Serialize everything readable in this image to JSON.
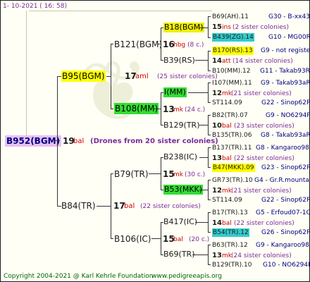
{
  "header": {
    "timestamp": "1-  10-2021  (  16:  58)"
  },
  "watermark": {
    "glyph": "❦"
  },
  "root": {
    "id": "B952(BGM)",
    "count": "19",
    "suffix": "bal",
    "colonies": "(Drones from 20 sister colonies)"
  },
  "g1": {
    "mother": {
      "id": "B95(BGM)",
      "count": "17",
      "suffix": "aml",
      "colonies": "(25 sister colonies)"
    },
    "father": {
      "id": "B84(TR)",
      "count": "17",
      "suffix": "bal",
      "colonies": "(22 sister colonies)"
    }
  },
  "g2": {
    "a": {
      "id": "B121(BGM)",
      "count": "16",
      "suffix": "hbg",
      "colonies": "(8 c.)"
    },
    "b": {
      "id": "B108(MM)",
      "count": "13",
      "suffix": "mk",
      "colonies": "(24 c.)"
    },
    "c": {
      "id": "B79(TR)",
      "count": "15",
      "suffix": "mk",
      "colonies": "(30 c.)"
    },
    "d": {
      "id": "B106(IC)",
      "count": "15",
      "suffix": "bal",
      "colonies": "(20 c.)"
    }
  },
  "g3": {
    "a1": "B18(BGM)",
    "a2": "B39(RS)",
    "b1": "I(MM)",
    "b2": "B129(TR)",
    "c1": "B238(IC)",
    "c2": "B53(MKK)",
    "d1": "B417(IC)",
    "d2": "B69(TR)"
  },
  "g4": [
    {
      "id": "B69(AH).11",
      "ref": "G30 - B-xx43"
    },
    {
      "count": "15",
      "suffix": "ins",
      "colonies": "(2 sister colonies)"
    },
    {
      "id": "B439(ZG).14",
      "ref": "G10 - MG00R"
    },
    {
      "id": "B170(RS).13",
      "ref": "G9 - not registe"
    },
    {
      "count": "14",
      "suffix": "att",
      "colonies": "(14 sister colonies)"
    },
    {
      "id": "B10(MM).12",
      "ref": "G11 - Takab93R"
    },
    {
      "id": "I107(MM).11",
      "ref": "G9 - Takab93aR"
    },
    {
      "count": "12",
      "suffix": "mk",
      "colonies": "(21 sister colonies)"
    },
    {
      "id": "ST114.09",
      "ref": "G22 - Sinop62R"
    },
    {
      "id": "B82(TR).07",
      "ref": "G9 - NO6294R"
    },
    {
      "count": "10",
      "suffix": "bal",
      "colonies": "(23 sister colonies)"
    },
    {
      "id": "B135(TR).06",
      "ref": "G8 - Takab93aR"
    },
    {
      "id": "B137(TR).11",
      "ref": "G8 - Kangaroo98R"
    },
    {
      "count": "13",
      "suffix": "bal",
      "colonies": "(22 sister colonies)"
    },
    {
      "id": "B47(MKK).09",
      "ref": "G23 - Sinop62R"
    },
    {
      "id": "GR73(TR).10",
      "ref": "G4 - Gr.R.mounta"
    },
    {
      "count": "12",
      "suffix": "mk",
      "colonies": "(21 sister colonies)"
    },
    {
      "id": "ST114.09",
      "ref": "G22 - Sinop62R"
    },
    {
      "id": "B17(TR).13",
      "ref": "G5 - Erfoud07-1Q"
    },
    {
      "count": "14",
      "suffix": "bal",
      "colonies": "(22 sister colonies)"
    },
    {
      "id": "B54(TR).12",
      "ref": "G26 - Sinop62R"
    },
    {
      "id": "B63(TR).12",
      "ref": "G9 - Kangaroo98R"
    },
    {
      "count": "13",
      "suffix": "mk",
      "colonies": "(24 sister colonies)"
    },
    {
      "id": "B129(TR).10",
      "ref": "G10 - NO6294R"
    }
  ],
  "footer": {
    "copyright": "Copyright 2004-2021 @ Karl Kehrle Foundation",
    "url": "www.pedigreeapis.org"
  }
}
